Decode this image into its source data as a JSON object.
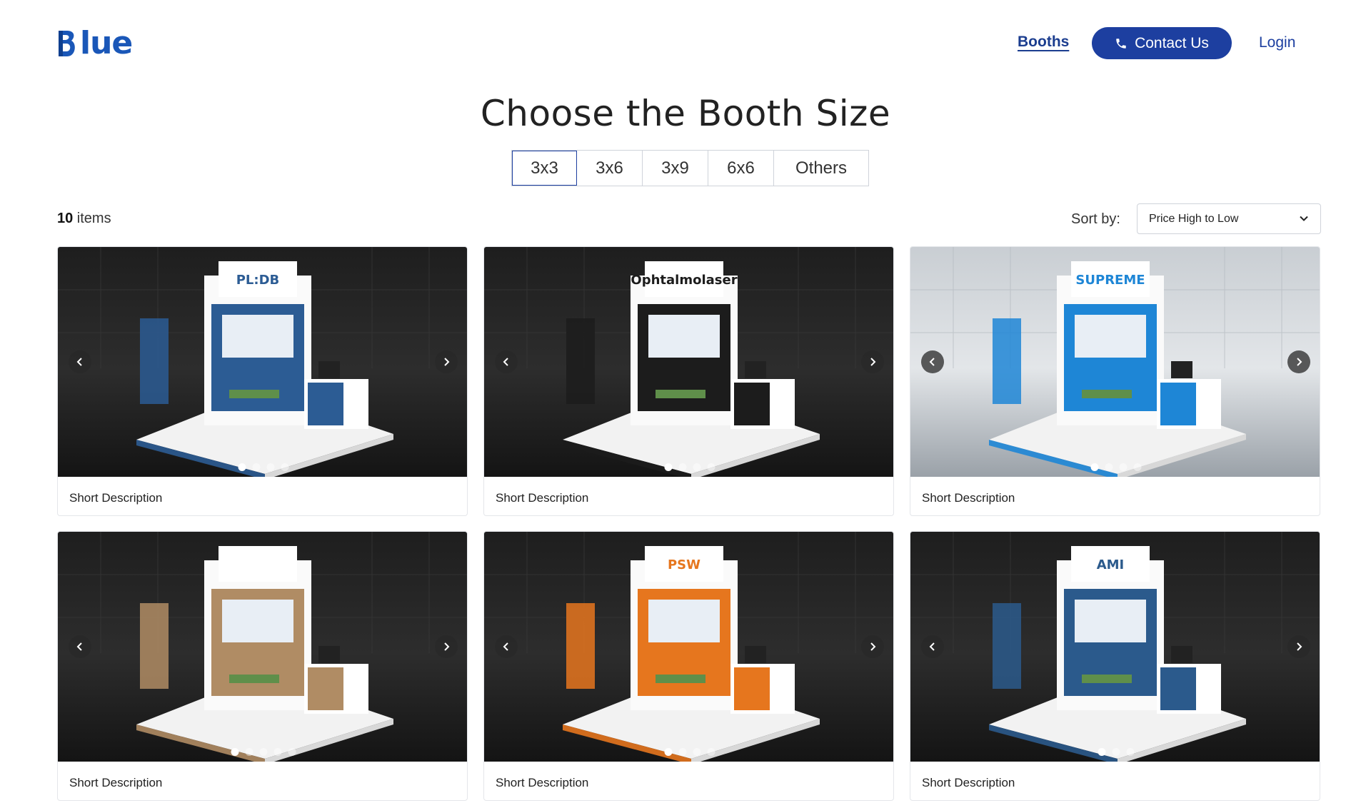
{
  "brand": {
    "logo_text": "lue",
    "accent": "#1d3fa0"
  },
  "nav": {
    "booths": "Booths",
    "contact": "Contact Us",
    "login": "Login"
  },
  "title": "Choose the Booth Size",
  "size_tabs": [
    {
      "label": "3x3",
      "active": true
    },
    {
      "label": "3x6",
      "active": false
    },
    {
      "label": "3x9",
      "active": false
    },
    {
      "label": "6x6",
      "active": false
    },
    {
      "label": "Others",
      "active": false
    }
  ],
  "items": {
    "count": "10",
    "suffix": " items"
  },
  "sort": {
    "label": "Sort by:",
    "value": "Price High to Low"
  },
  "cards": [
    {
      "description": "Short Description",
      "theme": "dark",
      "brand_color": "#2c5c94",
      "sign": "PL:DB",
      "dots": 4,
      "active_dot": 0
    },
    {
      "description": "Short Description",
      "theme": "dark",
      "brand_color": "#1c1c1c",
      "sign": "Ophtalmolaser",
      "dots": 4,
      "active_dot": 0
    },
    {
      "description": "Short Description",
      "theme": "light",
      "brand_color": "#1e86d6",
      "sign": "SUPREME",
      "dots": 4,
      "active_dot": 0
    },
    {
      "description": "Short Description",
      "theme": "dark",
      "brand_color": "#b08c64",
      "sign": "",
      "dots": 5,
      "active_dot": 0
    },
    {
      "description": "Short Description",
      "theme": "dark",
      "brand_color": "#e6761e",
      "sign": "PSW",
      "dots": 4,
      "active_dot": 0
    },
    {
      "description": "Short Description",
      "theme": "dark",
      "brand_color": "#2b5a8c",
      "sign": "AMI",
      "dots": 3,
      "active_dot": 0
    }
  ]
}
